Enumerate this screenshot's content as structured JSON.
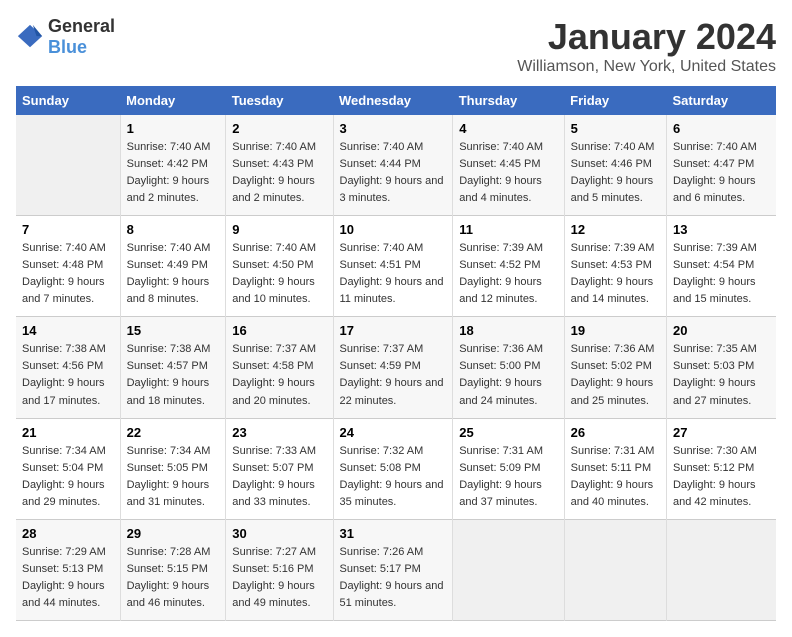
{
  "logo": {
    "general": "General",
    "blue": "Blue"
  },
  "title": "January 2024",
  "subtitle": "Williamson, New York, United States",
  "days_of_week": [
    "Sunday",
    "Monday",
    "Tuesday",
    "Wednesday",
    "Thursday",
    "Friday",
    "Saturday"
  ],
  "weeks": [
    [
      {
        "day": "",
        "sunrise": "",
        "sunset": "",
        "daylight": ""
      },
      {
        "day": "1",
        "sunrise": "Sunrise: 7:40 AM",
        "sunset": "Sunset: 4:42 PM",
        "daylight": "Daylight: 9 hours and 2 minutes."
      },
      {
        "day": "2",
        "sunrise": "Sunrise: 7:40 AM",
        "sunset": "Sunset: 4:43 PM",
        "daylight": "Daylight: 9 hours and 2 minutes."
      },
      {
        "day": "3",
        "sunrise": "Sunrise: 7:40 AM",
        "sunset": "Sunset: 4:44 PM",
        "daylight": "Daylight: 9 hours and 3 minutes."
      },
      {
        "day": "4",
        "sunrise": "Sunrise: 7:40 AM",
        "sunset": "Sunset: 4:45 PM",
        "daylight": "Daylight: 9 hours and 4 minutes."
      },
      {
        "day": "5",
        "sunrise": "Sunrise: 7:40 AM",
        "sunset": "Sunset: 4:46 PM",
        "daylight": "Daylight: 9 hours and 5 minutes."
      },
      {
        "day": "6",
        "sunrise": "Sunrise: 7:40 AM",
        "sunset": "Sunset: 4:47 PM",
        "daylight": "Daylight: 9 hours and 6 minutes."
      }
    ],
    [
      {
        "day": "7",
        "sunrise": "Sunrise: 7:40 AM",
        "sunset": "Sunset: 4:48 PM",
        "daylight": "Daylight: 9 hours and 7 minutes."
      },
      {
        "day": "8",
        "sunrise": "Sunrise: 7:40 AM",
        "sunset": "Sunset: 4:49 PM",
        "daylight": "Daylight: 9 hours and 8 minutes."
      },
      {
        "day": "9",
        "sunrise": "Sunrise: 7:40 AM",
        "sunset": "Sunset: 4:50 PM",
        "daylight": "Daylight: 9 hours and 10 minutes."
      },
      {
        "day": "10",
        "sunrise": "Sunrise: 7:40 AM",
        "sunset": "Sunset: 4:51 PM",
        "daylight": "Daylight: 9 hours and 11 minutes."
      },
      {
        "day": "11",
        "sunrise": "Sunrise: 7:39 AM",
        "sunset": "Sunset: 4:52 PM",
        "daylight": "Daylight: 9 hours and 12 minutes."
      },
      {
        "day": "12",
        "sunrise": "Sunrise: 7:39 AM",
        "sunset": "Sunset: 4:53 PM",
        "daylight": "Daylight: 9 hours and 14 minutes."
      },
      {
        "day": "13",
        "sunrise": "Sunrise: 7:39 AM",
        "sunset": "Sunset: 4:54 PM",
        "daylight": "Daylight: 9 hours and 15 minutes."
      }
    ],
    [
      {
        "day": "14",
        "sunrise": "Sunrise: 7:38 AM",
        "sunset": "Sunset: 4:56 PM",
        "daylight": "Daylight: 9 hours and 17 minutes."
      },
      {
        "day": "15",
        "sunrise": "Sunrise: 7:38 AM",
        "sunset": "Sunset: 4:57 PM",
        "daylight": "Daylight: 9 hours and 18 minutes."
      },
      {
        "day": "16",
        "sunrise": "Sunrise: 7:37 AM",
        "sunset": "Sunset: 4:58 PM",
        "daylight": "Daylight: 9 hours and 20 minutes."
      },
      {
        "day": "17",
        "sunrise": "Sunrise: 7:37 AM",
        "sunset": "Sunset: 4:59 PM",
        "daylight": "Daylight: 9 hours and 22 minutes."
      },
      {
        "day": "18",
        "sunrise": "Sunrise: 7:36 AM",
        "sunset": "Sunset: 5:00 PM",
        "daylight": "Daylight: 9 hours and 24 minutes."
      },
      {
        "day": "19",
        "sunrise": "Sunrise: 7:36 AM",
        "sunset": "Sunset: 5:02 PM",
        "daylight": "Daylight: 9 hours and 25 minutes."
      },
      {
        "day": "20",
        "sunrise": "Sunrise: 7:35 AM",
        "sunset": "Sunset: 5:03 PM",
        "daylight": "Daylight: 9 hours and 27 minutes."
      }
    ],
    [
      {
        "day": "21",
        "sunrise": "Sunrise: 7:34 AM",
        "sunset": "Sunset: 5:04 PM",
        "daylight": "Daylight: 9 hours and 29 minutes."
      },
      {
        "day": "22",
        "sunrise": "Sunrise: 7:34 AM",
        "sunset": "Sunset: 5:05 PM",
        "daylight": "Daylight: 9 hours and 31 minutes."
      },
      {
        "day": "23",
        "sunrise": "Sunrise: 7:33 AM",
        "sunset": "Sunset: 5:07 PM",
        "daylight": "Daylight: 9 hours and 33 minutes."
      },
      {
        "day": "24",
        "sunrise": "Sunrise: 7:32 AM",
        "sunset": "Sunset: 5:08 PM",
        "daylight": "Daylight: 9 hours and 35 minutes."
      },
      {
        "day": "25",
        "sunrise": "Sunrise: 7:31 AM",
        "sunset": "Sunset: 5:09 PM",
        "daylight": "Daylight: 9 hours and 37 minutes."
      },
      {
        "day": "26",
        "sunrise": "Sunrise: 7:31 AM",
        "sunset": "Sunset: 5:11 PM",
        "daylight": "Daylight: 9 hours and 40 minutes."
      },
      {
        "day": "27",
        "sunrise": "Sunrise: 7:30 AM",
        "sunset": "Sunset: 5:12 PM",
        "daylight": "Daylight: 9 hours and 42 minutes."
      }
    ],
    [
      {
        "day": "28",
        "sunrise": "Sunrise: 7:29 AM",
        "sunset": "Sunset: 5:13 PM",
        "daylight": "Daylight: 9 hours and 44 minutes."
      },
      {
        "day": "29",
        "sunrise": "Sunrise: 7:28 AM",
        "sunset": "Sunset: 5:15 PM",
        "daylight": "Daylight: 9 hours and 46 minutes."
      },
      {
        "day": "30",
        "sunrise": "Sunrise: 7:27 AM",
        "sunset": "Sunset: 5:16 PM",
        "daylight": "Daylight: 9 hours and 49 minutes."
      },
      {
        "day": "31",
        "sunrise": "Sunrise: 7:26 AM",
        "sunset": "Sunset: 5:17 PM",
        "daylight": "Daylight: 9 hours and 51 minutes."
      },
      {
        "day": "",
        "sunrise": "",
        "sunset": "",
        "daylight": ""
      },
      {
        "day": "",
        "sunrise": "",
        "sunset": "",
        "daylight": ""
      },
      {
        "day": "",
        "sunrise": "",
        "sunset": "",
        "daylight": ""
      }
    ]
  ]
}
